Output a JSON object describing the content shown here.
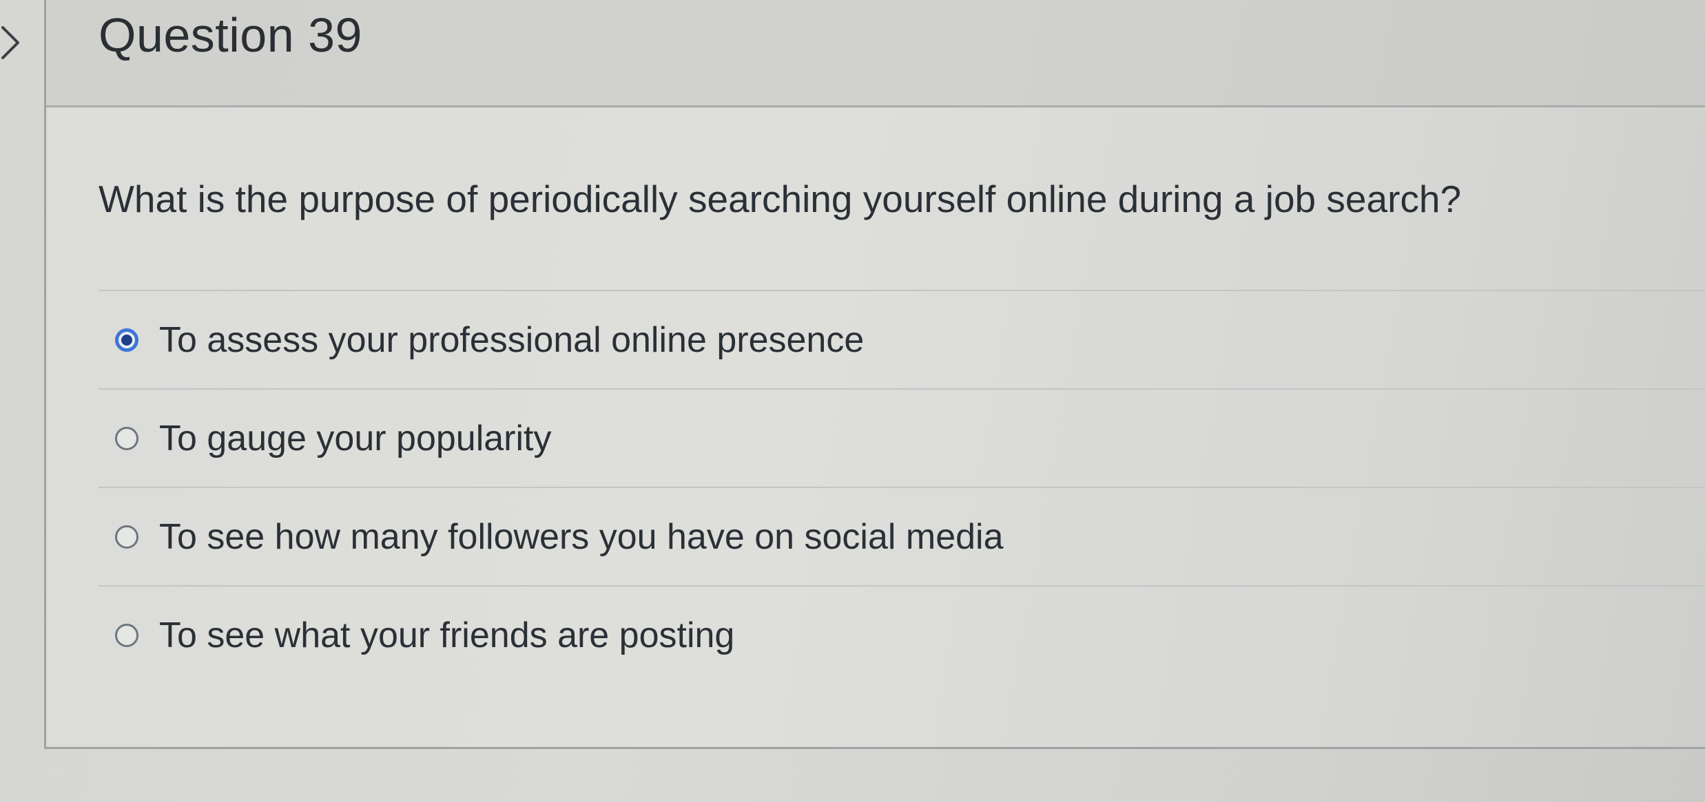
{
  "question": {
    "title": "Question 39",
    "text": "What is the purpose of periodically searching yourself online during a job search?"
  },
  "answers": [
    {
      "label": "To assess your professional online presence",
      "selected": true
    },
    {
      "label": "To gauge your popularity",
      "selected": false
    },
    {
      "label": "To see how many followers you have on social media",
      "selected": false
    },
    {
      "label": "To see what your friends are posting",
      "selected": false
    }
  ],
  "icons": {
    "collapse": "chevron-right-icon",
    "radio_selected": "radio-selected-icon",
    "radio_unselected": "radio-unselected-icon"
  },
  "colors": {
    "accent": "#3c74d8",
    "radio_dot": "#1d3f8a",
    "text": "#2a3036"
  }
}
